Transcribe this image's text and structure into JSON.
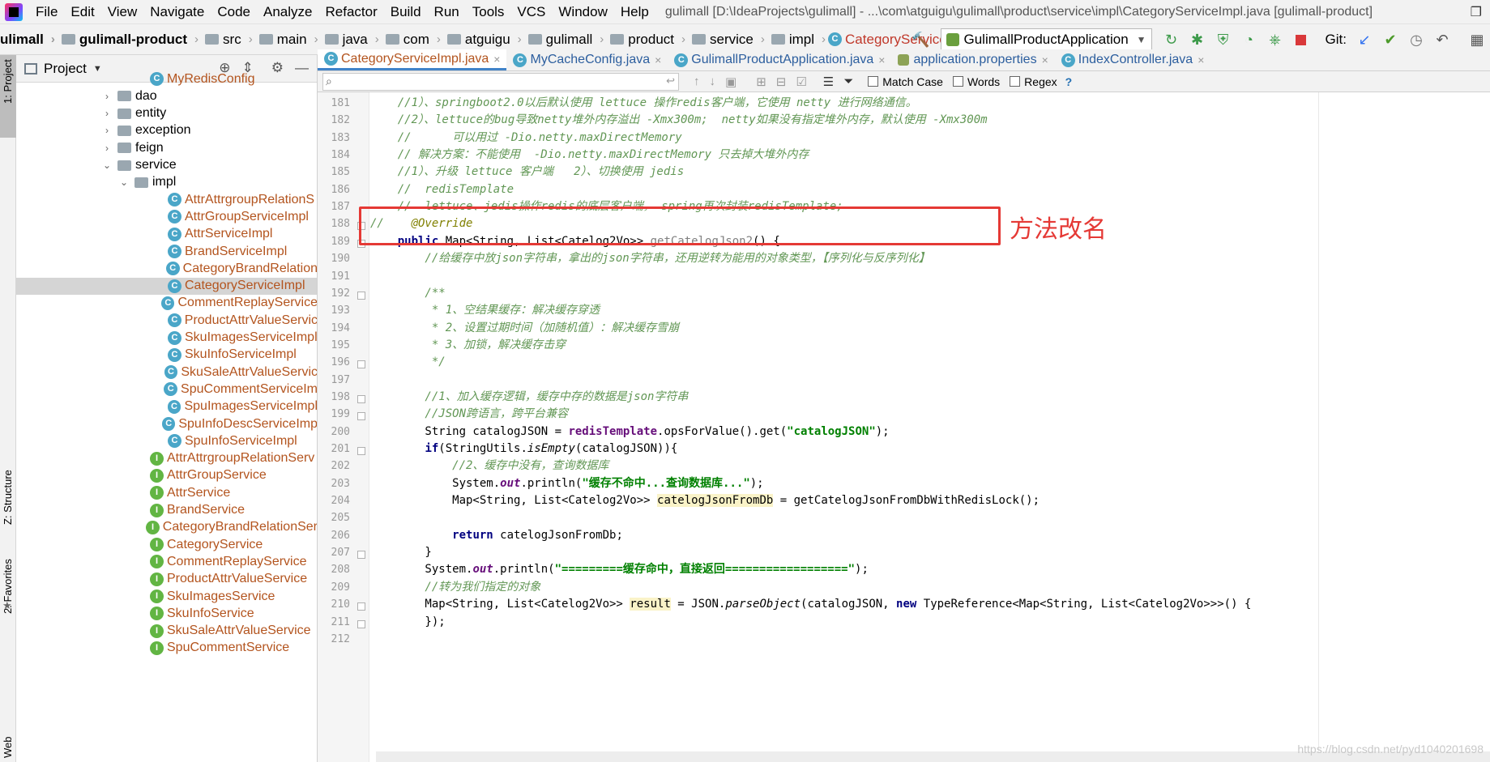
{
  "menubar": {
    "items": [
      "File",
      "Edit",
      "View",
      "Navigate",
      "Code",
      "Analyze",
      "Refactor",
      "Build",
      "Run",
      "Tools",
      "VCS",
      "Window",
      "Help"
    ],
    "title": "gulimall [D:\\IdeaProjects\\gulimall] - ...\\com\\atguigu\\gulimall\\product\\service\\impl\\CategoryServiceImpl.java [gulimall-product]",
    "window_control": "❐"
  },
  "navbar": {
    "crumbs": [
      "ulimall",
      "gulimall-product",
      "src",
      "main",
      "java",
      "com",
      "atguigu",
      "gulimall",
      "product",
      "service",
      "impl",
      "CategoryServiceImpl"
    ],
    "run_config": "GulimallProductApplication",
    "git_label": "Git:"
  },
  "leftstrip": {
    "project": "1: Project",
    "structure": "Z: Structure",
    "favorites": "2: Favorites",
    "web": "Web"
  },
  "project_panel": {
    "title": "Project",
    "tree": [
      {
        "label": "MyRedisConfig",
        "kind": "class",
        "indent": 185
      },
      {
        "label": "dao",
        "kind": "package",
        "indent": 145,
        "arrow": "›"
      },
      {
        "label": "entity",
        "kind": "package",
        "indent": 145,
        "arrow": "›"
      },
      {
        "label": "exception",
        "kind": "package",
        "indent": 145,
        "arrow": "›"
      },
      {
        "label": "feign",
        "kind": "package",
        "indent": 145,
        "arrow": "›"
      },
      {
        "label": "service",
        "kind": "package",
        "indent": 145,
        "arrow": "⌄"
      },
      {
        "label": "impl",
        "kind": "package",
        "indent": 166,
        "arrow": "⌄"
      },
      {
        "label": "AttrAttrgroupRelationS",
        "kind": "class",
        "indent": 207
      },
      {
        "label": "AttrGroupServiceImpl",
        "kind": "class",
        "indent": 207
      },
      {
        "label": "AttrServiceImpl",
        "kind": "class",
        "indent": 207
      },
      {
        "label": "BrandServiceImpl",
        "kind": "class",
        "indent": 207
      },
      {
        "label": "CategoryBrandRelation",
        "kind": "class",
        "indent": 207
      },
      {
        "label": "CategoryServiceImpl",
        "kind": "class",
        "indent": 207,
        "selected": true
      },
      {
        "label": "CommentReplayService",
        "kind": "class",
        "indent": 207
      },
      {
        "label": "ProductAttrValueServic",
        "kind": "class",
        "indent": 207
      },
      {
        "label": "SkuImagesServiceImpl",
        "kind": "class",
        "indent": 207
      },
      {
        "label": "SkuInfoServiceImpl",
        "kind": "class",
        "indent": 207
      },
      {
        "label": "SkuSaleAttrValueServic",
        "kind": "class",
        "indent": 207
      },
      {
        "label": "SpuCommentServiceIm",
        "kind": "class",
        "indent": 207
      },
      {
        "label": "SpuImagesServiceImpl",
        "kind": "class",
        "indent": 207
      },
      {
        "label": "SpuInfoDescServiceImp",
        "kind": "class",
        "indent": 207
      },
      {
        "label": "SpuInfoServiceImpl",
        "kind": "class",
        "indent": 207
      },
      {
        "label": "AttrAttrgroupRelationServ",
        "kind": "interface",
        "indent": 185
      },
      {
        "label": "AttrGroupService",
        "kind": "interface",
        "indent": 185
      },
      {
        "label": "AttrService",
        "kind": "interface",
        "indent": 185
      },
      {
        "label": "BrandService",
        "kind": "interface",
        "indent": 185
      },
      {
        "label": "CategoryBrandRelationSer",
        "kind": "interface",
        "indent": 185
      },
      {
        "label": "CategoryService",
        "kind": "interface",
        "indent": 185
      },
      {
        "label": "CommentReplayService",
        "kind": "interface",
        "indent": 185
      },
      {
        "label": "ProductAttrValueService",
        "kind": "interface",
        "indent": 185
      },
      {
        "label": "SkuImagesService",
        "kind": "interface",
        "indent": 185
      },
      {
        "label": "SkuInfoService",
        "kind": "interface",
        "indent": 185
      },
      {
        "label": "SkuSaleAttrValueService",
        "kind": "interface",
        "indent": 185
      },
      {
        "label": "SpuCommentService",
        "kind": "interface",
        "indent": 185
      }
    ]
  },
  "tabs": [
    {
      "label": "CategoryServiceImpl.java",
      "icon": "class",
      "active": true
    },
    {
      "label": "MyCacheConfig.java",
      "icon": "class"
    },
    {
      "label": "GulimallProductApplication.java",
      "icon": "class"
    },
    {
      "label": "application.properties",
      "icon": "properties"
    },
    {
      "label": "IndexController.java",
      "icon": "class"
    }
  ],
  "searchbar": {
    "match_case": "Match Case",
    "words": "Words",
    "regex": "Regex",
    "help": "?"
  },
  "editor": {
    "first_line": 181,
    "line_numbers": [
      "181",
      "182",
      "183",
      "184",
      "185",
      "186",
      "187",
      "188",
      "189",
      "190",
      "191",
      "192",
      "193",
      "194",
      "195",
      "196",
      "197",
      "198",
      "199",
      "200",
      "201",
      "202",
      "203",
      "204",
      "205",
      "206",
      "207",
      "208",
      "209",
      "210",
      "211",
      "212"
    ]
  },
  "code_lines": [
    [
      {
        "t": "    //1）、springboot2.0以后默认使用 lettuce 操作redis客户端，它使用 netty 进行网络通信。",
        "c": "c-cmt"
      }
    ],
    [
      {
        "t": "    //2）、lettuce的bug导致netty堆外内存溢出 -Xmx300m;  netty如果没有指定堆外内存，默认使用 -Xmx300m",
        "c": "c-cmt"
      }
    ],
    [
      {
        "t": "    //      可以用过 -Dio.netty.maxDirectMemory",
        "c": "c-cmt"
      }
    ],
    [
      {
        "t": "    // 解决方案：不能使用  -Dio.netty.maxDirectMemory 只去掉大堆外内存",
        "c": "c-cmt"
      }
    ],
    [
      {
        "t": "    //1）、升级 lettuce 客户端   2）、切换使用 jedis",
        "c": "c-cmt"
      }
    ],
    [
      {
        "t": "    //  redisTemplate",
        "c": "c-cmt"
      }
    ],
    [
      {
        "t": "    //  lettuce、jedis操作redis的底层客户端， spring再次封装redisTemplate;",
        "c": "c-cmt"
      }
    ],
    [
      {
        "t": "//    ",
        "c": "c-cmt"
      },
      {
        "t": "@Override",
        "c": "c-ann"
      }
    ],
    [
      {
        "t": "    "
      },
      {
        "t": "public",
        "c": "c-kw"
      },
      {
        "t": " Map<String, List<Catelog2Vo>> "
      },
      {
        "t": "getCatelogJson2",
        "c": "c-gray"
      },
      {
        "t": "() {"
      }
    ],
    [
      {
        "t": "        //给缓存中放json字符串，拿出的json字符串，还用逆转为能用的对象类型，【序列化与反序列化】",
        "c": "c-cmt"
      }
    ],
    [
      {
        "t": ""
      }
    ],
    [
      {
        "t": "        /**",
        "c": "c-doc"
      }
    ],
    [
      {
        "t": "         * 1、空结果缓存：解决缓存穿透",
        "c": "c-doc"
      }
    ],
    [
      {
        "t": "         * 2、设置过期时间（加随机值）：解决缓存雪崩",
        "c": "c-doc"
      }
    ],
    [
      {
        "t": "         * 3、加锁，解决缓存击穿",
        "c": "c-doc"
      }
    ],
    [
      {
        "t": "         */",
        "c": "c-doc"
      }
    ],
    [
      {
        "t": ""
      }
    ],
    [
      {
        "t": "        //1、加入缓存逻辑，缓存中存的数据是json字符串",
        "c": "c-cmt"
      }
    ],
    [
      {
        "t": "        //JSON跨语言，跨平台兼容",
        "c": "c-cmt"
      }
    ],
    [
      {
        "t": "        String catalogJSON = "
      },
      {
        "t": "redisTemplate",
        "c": "c-fld"
      },
      {
        "t": ".opsForValue().get("
      },
      {
        "t": "\"catalogJSON\"",
        "c": "c-str"
      },
      {
        "t": ");"
      }
    ],
    [
      {
        "t": "        "
      },
      {
        "t": "if",
        "c": "c-kw"
      },
      {
        "t": "(StringUtils."
      },
      {
        "t": "isEmpty",
        "c": "c-it"
      },
      {
        "t": "(catalogJSON)){"
      }
    ],
    [
      {
        "t": "            //2、缓存中没有，查询数据库",
        "c": "c-cmt"
      }
    ],
    [
      {
        "t": "            System."
      },
      {
        "t": "out",
        "c": "c-st"
      },
      {
        "t": ".println("
      },
      {
        "t": "\"缓存不命中...查询数据库...\"",
        "c": "c-str"
      },
      {
        "t": ");"
      }
    ],
    [
      {
        "t": "            Map<String, List<Catelog2Vo>> "
      },
      {
        "t": "catelogJsonFromDb",
        "c": "c-hl"
      },
      {
        "t": " = getCatelogJsonFromDbWithRedisLock();"
      }
    ],
    [
      {
        "t": ""
      }
    ],
    [
      {
        "t": "            "
      },
      {
        "t": "return",
        "c": "c-kw"
      },
      {
        "t": " catelogJsonFromDb;"
      }
    ],
    [
      {
        "t": "        }"
      }
    ],
    [
      {
        "t": "        System."
      },
      {
        "t": "out",
        "c": "c-st"
      },
      {
        "t": ".println("
      },
      {
        "t": "\"=========缓存命中，直接返回==================\"",
        "c": "c-str"
      },
      {
        "t": ");"
      }
    ],
    [
      {
        "t": "        //转为我们指定的对象",
        "c": "c-cmt"
      }
    ],
    [
      {
        "t": "        Map<String, List<Catelog2Vo>> "
      },
      {
        "t": "result",
        "c": "c-hl"
      },
      {
        "t": " = JSON."
      },
      {
        "t": "parseObject",
        "c": "c-it"
      },
      {
        "t": "(catalogJSON, "
      },
      {
        "t": "new",
        "c": "c-kw"
      },
      {
        "t": " TypeReference<Map<String, List<Catelog2Vo>>>() {"
      }
    ],
    [
      {
        "t": "        });"
      }
    ],
    [
      {
        "t": ""
      }
    ]
  ],
  "annotation": {
    "label": "方法改名",
    "color": "#e53935"
  },
  "watermark": "https://blog.csdn.net/pyd1040201698"
}
